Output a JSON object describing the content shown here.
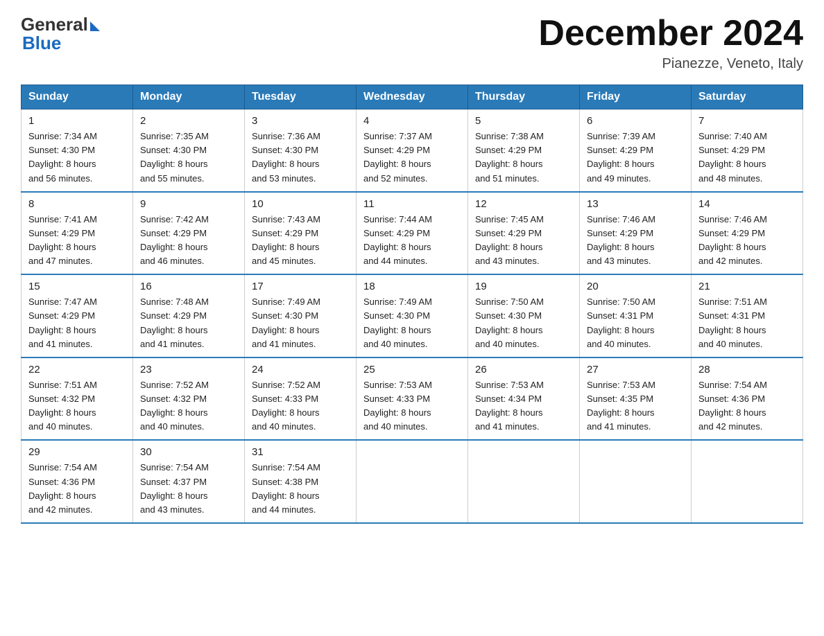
{
  "logo": {
    "general": "General",
    "blue": "Blue"
  },
  "title": "December 2024",
  "location": "Pianezze, Veneto, Italy",
  "headers": [
    "Sunday",
    "Monday",
    "Tuesday",
    "Wednesday",
    "Thursday",
    "Friday",
    "Saturday"
  ],
  "weeks": [
    [
      {
        "day": "1",
        "sunrise": "7:34 AM",
        "sunset": "4:30 PM",
        "daylight": "8 hours and 56 minutes."
      },
      {
        "day": "2",
        "sunrise": "7:35 AM",
        "sunset": "4:30 PM",
        "daylight": "8 hours and 55 minutes."
      },
      {
        "day": "3",
        "sunrise": "7:36 AM",
        "sunset": "4:30 PM",
        "daylight": "8 hours and 53 minutes."
      },
      {
        "day": "4",
        "sunrise": "7:37 AM",
        "sunset": "4:29 PM",
        "daylight": "8 hours and 52 minutes."
      },
      {
        "day": "5",
        "sunrise": "7:38 AM",
        "sunset": "4:29 PM",
        "daylight": "8 hours and 51 minutes."
      },
      {
        "day": "6",
        "sunrise": "7:39 AM",
        "sunset": "4:29 PM",
        "daylight": "8 hours and 49 minutes."
      },
      {
        "day": "7",
        "sunrise": "7:40 AM",
        "sunset": "4:29 PM",
        "daylight": "8 hours and 48 minutes."
      }
    ],
    [
      {
        "day": "8",
        "sunrise": "7:41 AM",
        "sunset": "4:29 PM",
        "daylight": "8 hours and 47 minutes."
      },
      {
        "day": "9",
        "sunrise": "7:42 AM",
        "sunset": "4:29 PM",
        "daylight": "8 hours and 46 minutes."
      },
      {
        "day": "10",
        "sunrise": "7:43 AM",
        "sunset": "4:29 PM",
        "daylight": "8 hours and 45 minutes."
      },
      {
        "day": "11",
        "sunrise": "7:44 AM",
        "sunset": "4:29 PM",
        "daylight": "8 hours and 44 minutes."
      },
      {
        "day": "12",
        "sunrise": "7:45 AM",
        "sunset": "4:29 PM",
        "daylight": "8 hours and 43 minutes."
      },
      {
        "day": "13",
        "sunrise": "7:46 AM",
        "sunset": "4:29 PM",
        "daylight": "8 hours and 43 minutes."
      },
      {
        "day": "14",
        "sunrise": "7:46 AM",
        "sunset": "4:29 PM",
        "daylight": "8 hours and 42 minutes."
      }
    ],
    [
      {
        "day": "15",
        "sunrise": "7:47 AM",
        "sunset": "4:29 PM",
        "daylight": "8 hours and 41 minutes."
      },
      {
        "day": "16",
        "sunrise": "7:48 AM",
        "sunset": "4:29 PM",
        "daylight": "8 hours and 41 minutes."
      },
      {
        "day": "17",
        "sunrise": "7:49 AM",
        "sunset": "4:30 PM",
        "daylight": "8 hours and 41 minutes."
      },
      {
        "day": "18",
        "sunrise": "7:49 AM",
        "sunset": "4:30 PM",
        "daylight": "8 hours and 40 minutes."
      },
      {
        "day": "19",
        "sunrise": "7:50 AM",
        "sunset": "4:30 PM",
        "daylight": "8 hours and 40 minutes."
      },
      {
        "day": "20",
        "sunrise": "7:50 AM",
        "sunset": "4:31 PM",
        "daylight": "8 hours and 40 minutes."
      },
      {
        "day": "21",
        "sunrise": "7:51 AM",
        "sunset": "4:31 PM",
        "daylight": "8 hours and 40 minutes."
      }
    ],
    [
      {
        "day": "22",
        "sunrise": "7:51 AM",
        "sunset": "4:32 PM",
        "daylight": "8 hours and 40 minutes."
      },
      {
        "day": "23",
        "sunrise": "7:52 AM",
        "sunset": "4:32 PM",
        "daylight": "8 hours and 40 minutes."
      },
      {
        "day": "24",
        "sunrise": "7:52 AM",
        "sunset": "4:33 PM",
        "daylight": "8 hours and 40 minutes."
      },
      {
        "day": "25",
        "sunrise": "7:53 AM",
        "sunset": "4:33 PM",
        "daylight": "8 hours and 40 minutes."
      },
      {
        "day": "26",
        "sunrise": "7:53 AM",
        "sunset": "4:34 PM",
        "daylight": "8 hours and 41 minutes."
      },
      {
        "day": "27",
        "sunrise": "7:53 AM",
        "sunset": "4:35 PM",
        "daylight": "8 hours and 41 minutes."
      },
      {
        "day": "28",
        "sunrise": "7:54 AM",
        "sunset": "4:36 PM",
        "daylight": "8 hours and 42 minutes."
      }
    ],
    [
      {
        "day": "29",
        "sunrise": "7:54 AM",
        "sunset": "4:36 PM",
        "daylight": "8 hours and 42 minutes."
      },
      {
        "day": "30",
        "sunrise": "7:54 AM",
        "sunset": "4:37 PM",
        "daylight": "8 hours and 43 minutes."
      },
      {
        "day": "31",
        "sunrise": "7:54 AM",
        "sunset": "4:38 PM",
        "daylight": "8 hours and 44 minutes."
      },
      null,
      null,
      null,
      null
    ]
  ]
}
